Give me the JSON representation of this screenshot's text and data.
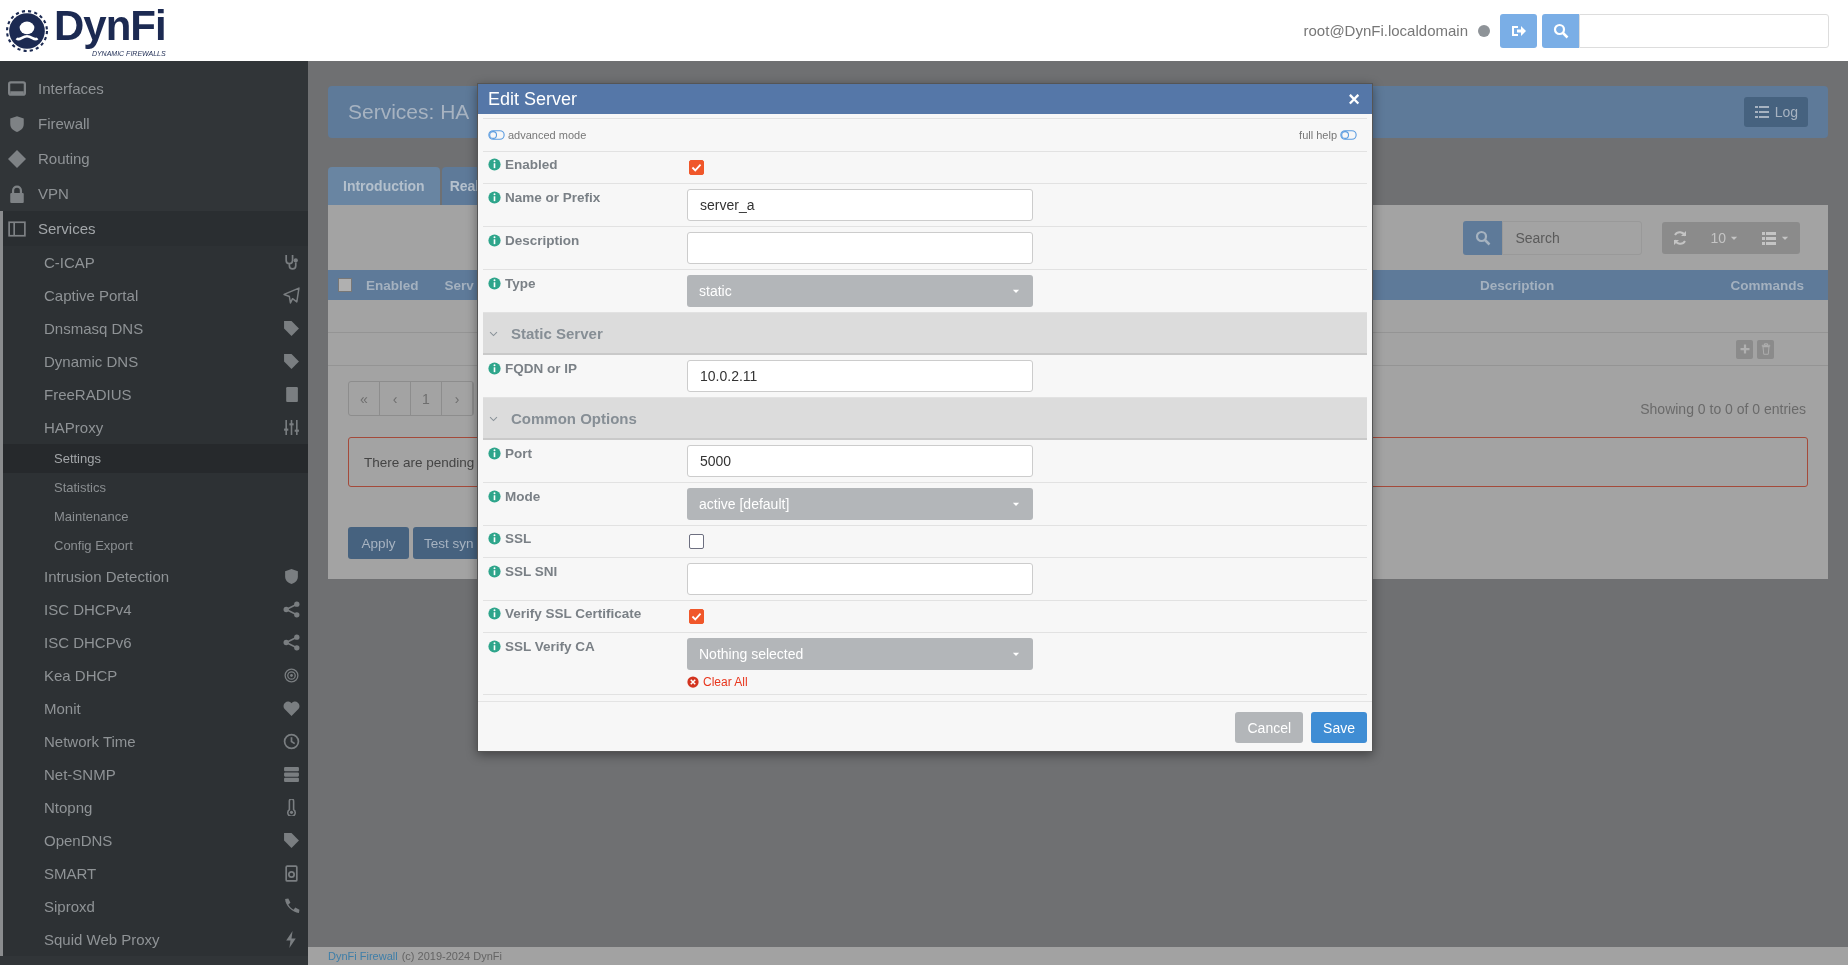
{
  "header": {
    "logo": "DynFi",
    "tagline": "DYNAMIC FIREWALLS",
    "user": "root@DynFi.localdomain"
  },
  "sidebar": {
    "items": [
      {
        "label": "Interfaces"
      },
      {
        "label": "Firewall"
      },
      {
        "label": "Routing"
      },
      {
        "label": "VPN"
      },
      {
        "label": "Services",
        "expanded": true,
        "children": [
          {
            "label": "C-ICAP"
          },
          {
            "label": "Captive Portal"
          },
          {
            "label": "Dnsmasq DNS"
          },
          {
            "label": "Dynamic DNS"
          },
          {
            "label": "FreeRADIUS"
          },
          {
            "label": "HAProxy",
            "expanded": true,
            "children": [
              {
                "label": "Settings",
                "selected": true
              },
              {
                "label": "Statistics",
                "selected": false
              },
              {
                "label": "Maintenance",
                "selected": false
              },
              {
                "label": "Config Export",
                "selected": false
              }
            ]
          },
          {
            "label": "Intrusion Detection"
          },
          {
            "label": "ISC DHCPv4"
          },
          {
            "label": "ISC DHCPv6"
          },
          {
            "label": "Kea DHCP"
          },
          {
            "label": "Monit"
          },
          {
            "label": "Network Time"
          },
          {
            "label": "Net-SNMP"
          },
          {
            "label": "Ntopng"
          },
          {
            "label": "OpenDNS"
          },
          {
            "label": "SMART"
          },
          {
            "label": "Siproxd"
          },
          {
            "label": "Squid Web Proxy"
          }
        ]
      }
    ]
  },
  "page": {
    "title": "Services: HA",
    "log_button": "Log",
    "tabs": [
      {
        "label": "Introduction",
        "selected": false
      },
      {
        "label": "Real",
        "selected": true
      }
    ],
    "grid": {
      "select_all_checked": false,
      "search_placeholder": "Search",
      "page_size": "10",
      "columns": [
        "Enabled",
        "Serv",
        "Description",
        "Commands"
      ],
      "pager": [
        "«",
        "‹",
        "1",
        "›"
      ],
      "info": "Showing 0 to 0 of 0 entries"
    },
    "alert": "There are pending",
    "buttons": [
      "Apply",
      "Test syn"
    ]
  },
  "modal": {
    "title": "Edit Server",
    "close": "×",
    "advanced_mode": "advanced mode",
    "full_help": "full help",
    "fields": [
      {
        "kind": "checkbox",
        "label": "Enabled",
        "checked": true
      },
      {
        "kind": "text",
        "label": "Name or Prefix",
        "value": "server_a"
      },
      {
        "kind": "text",
        "label": "Description"
      },
      {
        "kind": "select",
        "label": "Type",
        "value": "static"
      },
      {
        "kind": "section",
        "label": "Static Server",
        "expanded": true
      },
      {
        "kind": "text",
        "label": "FQDN or IP",
        "value": "10.0.2.11"
      },
      {
        "kind": "section",
        "label": "Common Options",
        "expanded": true
      },
      {
        "kind": "text",
        "label": "Port",
        "value": "5000"
      },
      {
        "kind": "select",
        "label": "Mode",
        "value": "active [default]"
      },
      {
        "kind": "checkbox",
        "label": "SSL",
        "checked": false
      },
      {
        "kind": "text",
        "label": "SSL SNI"
      },
      {
        "kind": "checkbox",
        "label": "Verify SSL Certificate",
        "checked": true
      },
      {
        "kind": "select",
        "label": "SSL Verify CA",
        "value": "Nothing selected",
        "clear_link": "Clear All"
      }
    ],
    "buttons": [
      {
        "label": "Cancel",
        "kind": "default"
      },
      {
        "label": "Save",
        "kind": "primary"
      }
    ]
  },
  "footer": {
    "link": "DynFi Firewall",
    "text": "(c) 2019-2024 DynFi"
  }
}
